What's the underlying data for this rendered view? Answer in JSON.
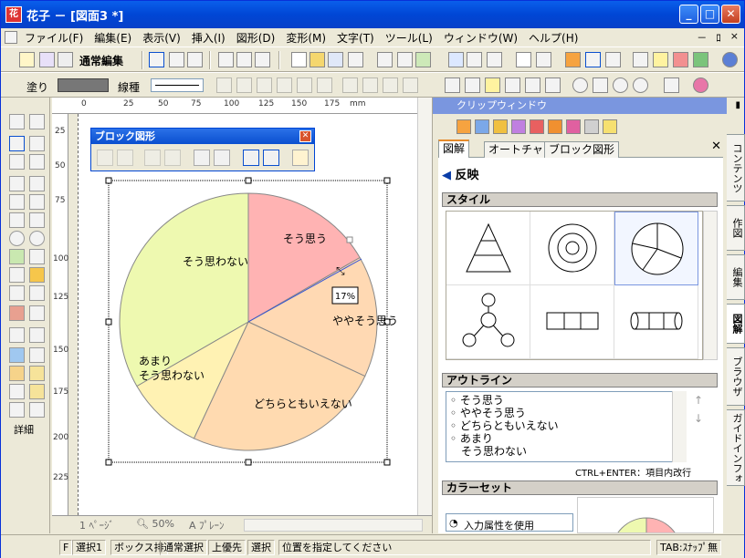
{
  "window": {
    "title": "花子 － [図面3 *]",
    "app_icon_label": "花",
    "minimize": "_",
    "maximize": "□",
    "close": "✕",
    "mdi_minimize": "－",
    "mdi_restore": "ﾛ",
    "mdi_close": "×"
  },
  "menu": [
    "ファイル(F)",
    "編集(E)",
    "表示(V)",
    "挿入(I)",
    "図形(D)",
    "変形(M)",
    "文字(T)",
    "ツール(L)",
    "ウィンドウ(W)",
    "ヘルプ(H)"
  ],
  "toolbar1": {
    "mode_label": "通常編集"
  },
  "toolbar2": {
    "fill_label": "塗り",
    "line_label": "線種",
    "fill_color": "#777777"
  },
  "left_palette": {
    "detail_label": "詳細"
  },
  "rulers": {
    "h_ticks": [
      "0",
      "25",
      "50",
      "75",
      "100",
      "125",
      "150",
      "175",
      "mm"
    ],
    "v_ticks": [
      "25",
      "50",
      "75",
      "100",
      "125",
      "150",
      "175",
      "200",
      "225"
    ]
  },
  "hscroll": {
    "page": "1 ﾍﾟｰｼﾞ",
    "zoom": "50%",
    "layer": "A ﾌﾟﾚｰﾝ"
  },
  "block_toolbar": {
    "title": "ブロック図形",
    "close": "✕"
  },
  "pie_chart": {
    "slices": [
      {
        "label": "そう思う",
        "color": "#FFB3B3"
      },
      {
        "label": "ややそう思う",
        "color": "#FFD9B3"
      },
      {
        "label": "どちらともいえない",
        "color": "#FFDAB0"
      },
      {
        "label": "あまり",
        "label2": "そう思わない",
        "color": "#FFF2B3"
      },
      {
        "label": "そう思わない",
        "color": "#EEF9B0"
      }
    ],
    "percent_tooltip": "17%"
  },
  "clip_window": {
    "title": "クリップウィンドウ",
    "tabs": [
      "図解",
      "オートチャート",
      "ブロック図形"
    ],
    "active_tab": "図解",
    "tab_close": "✕",
    "back_label": "反映",
    "style_header": "スタイル",
    "outline_header": "アウトライン",
    "outline_items": [
      "そう思う",
      "ややそう思う",
      "どちらともいえない",
      "あまり",
      "そう思わない"
    ],
    "outline_hint": "CTRL+ENTER：項目内改行",
    "colorset_header": "カラーセット",
    "apply_label": "入力属性を使用",
    "vertical_tabs": [
      "コンテンツ",
      "作図",
      "編集",
      "図解",
      "ブラウザ",
      "ガイドインフォ"
    ],
    "active_vertical_tab": "図解"
  },
  "status": [
    "F",
    "選択1",
    "ボックス排",
    "通常選択",
    "上優先",
    "選択",
    "位置を指定してください",
    "TAB:ｽﾅｯﾌﾟ無"
  ]
}
